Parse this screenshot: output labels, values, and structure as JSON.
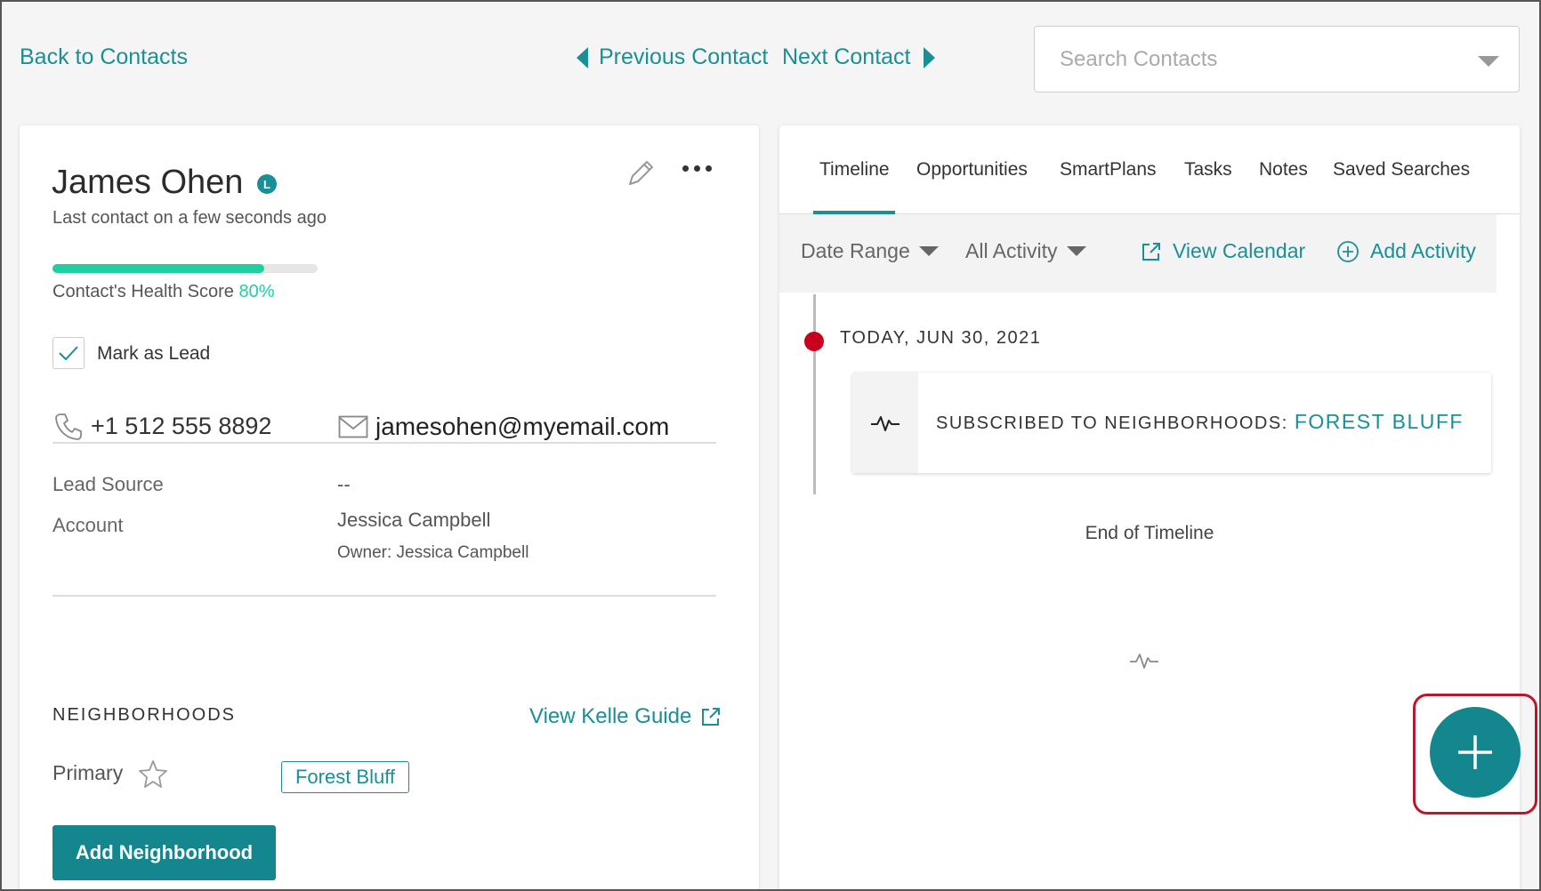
{
  "nav": {
    "back": "Back to Contacts",
    "previous": "Previous Contact",
    "next": "Next Contact",
    "search_placeholder": "Search Contacts"
  },
  "contact": {
    "name": "James Ohen",
    "badge": "L",
    "last_contact": "Last contact on a few seconds ago",
    "health_label": "Contact's Health Score",
    "health_score": "80%",
    "mark_as_lead": "Mark as Lead",
    "phone": "+1 512 555 8892",
    "email": "jamesohen@myemail.com"
  },
  "fields": {
    "lead_source_label": "Lead Source",
    "lead_source_value": "--",
    "account_label": "Account",
    "account_value": "Jessica Campbell",
    "owner": "Owner: Jessica Campbell"
  },
  "neighborhoods": {
    "heading": "NEIGHBORHOODS",
    "guide_link": "View Kelle Guide",
    "primary_label": "Primary",
    "tag": "Forest Bluff",
    "add_button": "Add Neighborhood"
  },
  "tabs": [
    "Timeline",
    "Opportunities",
    "SmartPlans",
    "Tasks",
    "Notes",
    "Saved Searches"
  ],
  "filters": {
    "date_range": "Date Range",
    "all_activity": "All Activity",
    "view_calendar": "View Calendar",
    "add_activity": "Add Activity"
  },
  "timeline": {
    "date": "TODAY, JUN 30, 2021",
    "event_prefix": "SUBSCRIBED TO NEIGHBORHOODS:",
    "event_value": "FOREST BLUFF",
    "end": "End of Timeline"
  },
  "colors": {
    "accent": "#1a8f96",
    "health": "#1fcf9f",
    "timeline_dot": "#c8001e",
    "highlight": "#c0142a"
  }
}
